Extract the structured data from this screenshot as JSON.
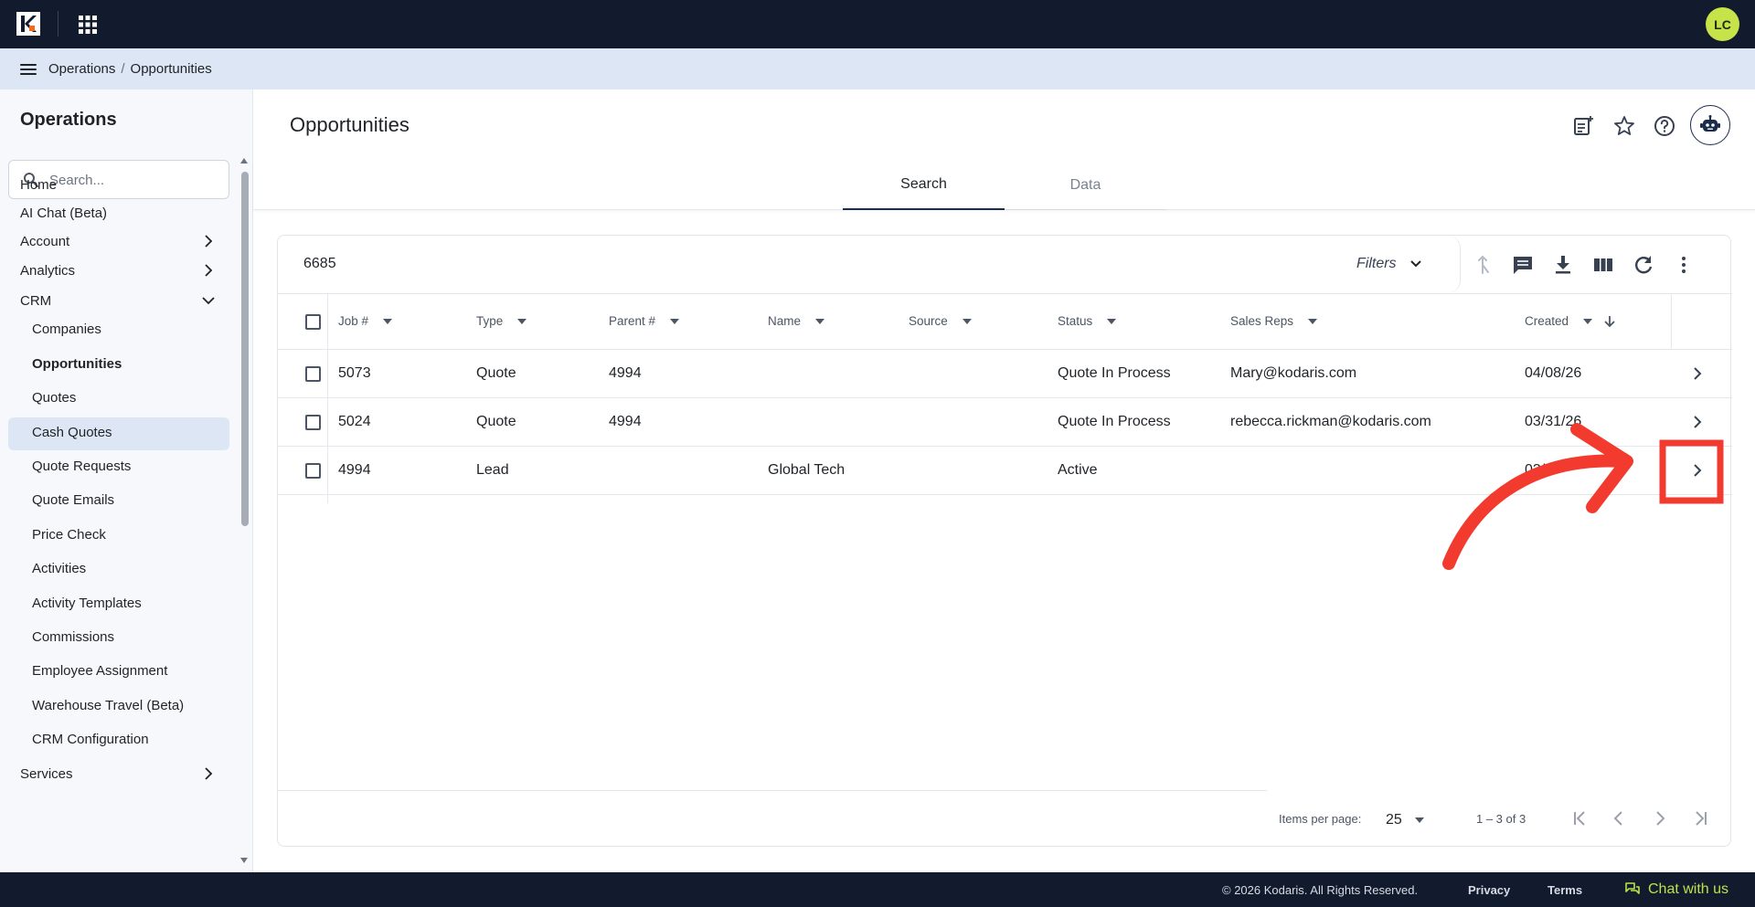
{
  "topbar": {
    "avatar_initials": "LC",
    "icons": [
      "kodaris-logo",
      "apps-grid-icon"
    ]
  },
  "breadcrumb": {
    "items": [
      "Operations",
      "Opportunities"
    ],
    "separator": "/"
  },
  "sidebar": {
    "title": "Operations",
    "search_placeholder": "Search...",
    "items": [
      {
        "label": "Home"
      },
      {
        "label": "AI Chat (Beta)"
      },
      {
        "label": "Account",
        "expandable": true
      },
      {
        "label": "Analytics",
        "expandable": true
      },
      {
        "label": "CRM",
        "expanded": true
      },
      {
        "label": "Services",
        "expandable": true
      }
    ],
    "crm_children": [
      "Companies",
      "Opportunities",
      "Quotes",
      "Cash Quotes",
      "Quote Requests",
      "Quote Emails",
      "Price Check",
      "Activities",
      "Activity Templates",
      "Commissions",
      "Employee Assignment",
      "Warehouse Travel (Beta)",
      "CRM Configuration"
    ],
    "active_item": "Opportunities"
  },
  "page": {
    "title": "Opportunities",
    "tabs": [
      {
        "label": "Search",
        "active": true
      },
      {
        "label": "Data",
        "active": false
      }
    ]
  },
  "table": {
    "total_count": "6685",
    "filters_label": "Filters",
    "columns": [
      "Job #",
      "Type",
      "Parent #",
      "Name",
      "Source",
      "Status",
      "Sales Reps",
      "Created"
    ],
    "rows": [
      {
        "job": "5073",
        "type": "Quote",
        "parent": "4994",
        "name": "",
        "source": "",
        "status": "Quote In Process",
        "sales_reps": "Mary@kodaris.com",
        "created": "04/08/26"
      },
      {
        "job": "5024",
        "type": "Quote",
        "parent": "4994",
        "name": "",
        "source": "",
        "status": "Quote In Process",
        "sales_reps": "rebecca.rickman@kodaris.com",
        "created": "03/31/26"
      },
      {
        "job": "4994",
        "type": "Lead",
        "parent": "",
        "name": "Global Tech",
        "source": "",
        "status": "Active",
        "sales_reps": "",
        "created": "03/"
      }
    ],
    "sort": {
      "column": "Created",
      "direction": "descending"
    },
    "pagination": {
      "items_per_page_label": "Items per page:",
      "items_per_page": "25",
      "range": "1 – 3 of 3"
    }
  },
  "footer": {
    "copyright": "© 2026 Kodaris. All Rights Reserved.",
    "privacy": "Privacy",
    "terms": "Terms",
    "chat": "Chat with us"
  },
  "colors": {
    "topbar_bg": "#121a2e",
    "breadcrumb_bg": "#dde6f5",
    "sidebar_bg": "#f6f8fc",
    "active_nav_bg": "#dde6f5",
    "avatar_bg": "#c6e34a",
    "tab_active_underline": "#1c2d4a",
    "annotation_red": "#f23a2f",
    "chat_green": "#b9e34a"
  }
}
